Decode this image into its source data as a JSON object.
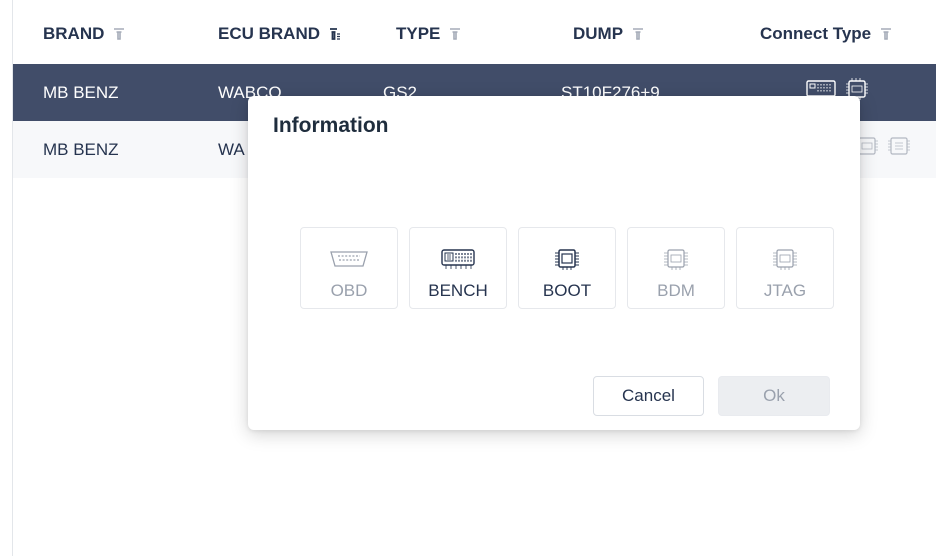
{
  "table": {
    "headers": {
      "brand": "BRAND",
      "ecu_brand": "ECU BRAND",
      "type": "TYPE",
      "dump": "DUMP",
      "connect_type": "Connect Type"
    },
    "rows": [
      {
        "brand": "MB BENZ",
        "ecu_brand": "WABCO",
        "type": "GS2",
        "dump": "ST10F276+9",
        "selected": true
      },
      {
        "brand": "MB BENZ",
        "ecu_brand": "WA",
        "selected": false
      }
    ]
  },
  "modal": {
    "title": "Information",
    "options": [
      {
        "label": "OBD",
        "icon": "obd-connector-icon",
        "enabled": false
      },
      {
        "label": "BENCH",
        "icon": "bench-connector-icon",
        "enabled": true
      },
      {
        "label": "BOOT",
        "icon": "boot-chip-icon",
        "enabled": true
      },
      {
        "label": "BDM",
        "icon": "bdm-chip-icon",
        "enabled": false
      },
      {
        "label": "JTAG",
        "icon": "jtag-chip-icon",
        "enabled": false
      }
    ],
    "cancel_label": "Cancel",
    "ok_label": "Ok"
  },
  "colors": {
    "selected_row": "#414d69",
    "header_text": "#26344f",
    "disabled_text": "#9aa1ad"
  }
}
